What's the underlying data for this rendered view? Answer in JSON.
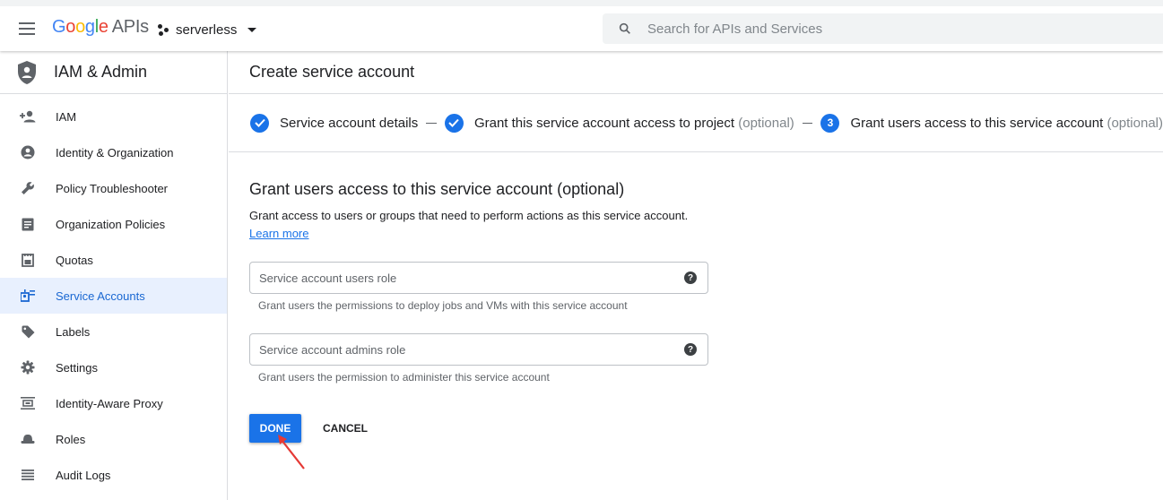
{
  "header": {
    "logo_letters": [
      "G",
      "o",
      "o",
      "g",
      "l",
      "e"
    ],
    "logo_suffix": "APIs",
    "project_name": "serverless",
    "search_placeholder": "Search for APIs and Services"
  },
  "sidebar": {
    "title": "IAM & Admin",
    "items": [
      {
        "label": "IAM",
        "icon": "person-add-icon"
      },
      {
        "label": "Identity & Organization",
        "icon": "account-circle-icon"
      },
      {
        "label": "Policy Troubleshooter",
        "icon": "wrench-icon"
      },
      {
        "label": "Organization Policies",
        "icon": "document-icon"
      },
      {
        "label": "Quotas",
        "icon": "quota-icon"
      },
      {
        "label": "Service Accounts",
        "icon": "service-account-icon",
        "active": true
      },
      {
        "label": "Labels",
        "icon": "tag-icon"
      },
      {
        "label": "Settings",
        "icon": "gear-icon"
      },
      {
        "label": "Identity-Aware Proxy",
        "icon": "proxy-icon"
      },
      {
        "label": "Roles",
        "icon": "hat-icon"
      },
      {
        "label": "Audit Logs",
        "icon": "list-icon"
      }
    ]
  },
  "main": {
    "page_title": "Create service account",
    "steps": [
      {
        "label": "Service account details",
        "optional": "",
        "state": "done"
      },
      {
        "label": "Grant this service account access to project",
        "optional": "(optional)",
        "state": "done"
      },
      {
        "number": "3",
        "label": "Grant users access to this service account",
        "optional": "(optional)",
        "state": "current"
      }
    ],
    "section_title": "Grant users access to this service account (optional)",
    "description": "Grant access to users or groups that need to perform actions as this service account.",
    "learn_more": "Learn more",
    "fields": [
      {
        "placeholder": "Service account users role",
        "hint": "Grant users the permissions to deploy jobs and VMs with this service account"
      },
      {
        "placeholder": "Service account admins role",
        "hint": "Grant users the permission to administer this service account"
      }
    ],
    "done_label": "DONE",
    "cancel_label": "CANCEL"
  },
  "colors": {
    "accent": "#1a73e8",
    "active_bg": "#e8f0fe",
    "annotation_arrow": "#e53935"
  }
}
